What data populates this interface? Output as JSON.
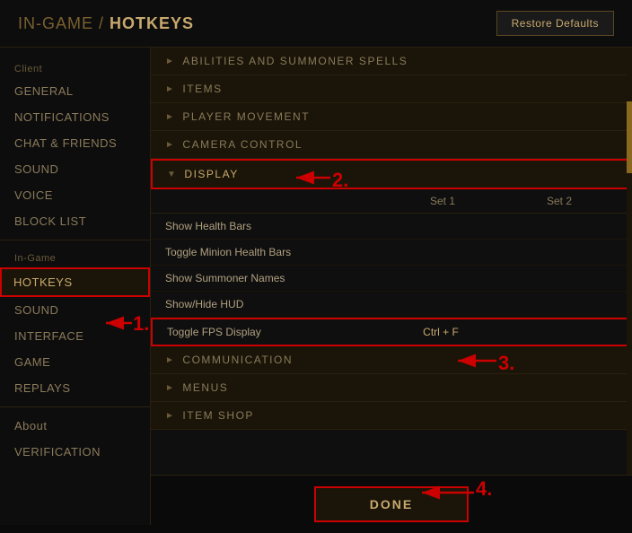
{
  "header": {
    "breadcrumb_prefix": "IN-GAME",
    "separator": " / ",
    "title": "HOTKEYS",
    "restore_button": "Restore Defaults"
  },
  "sidebar": {
    "client_label": "Client",
    "client_items": [
      {
        "id": "general",
        "label": "GENERAL",
        "active": false
      },
      {
        "id": "notifications",
        "label": "NOTIFICATIONS",
        "active": false
      },
      {
        "id": "chat-friends",
        "label": "CHAT & FRIENDS",
        "active": false
      },
      {
        "id": "sound-client",
        "label": "SOUND",
        "active": false
      },
      {
        "id": "voice",
        "label": "VOICE",
        "active": false
      },
      {
        "id": "block-list",
        "label": "BLOCK LIST",
        "active": false
      }
    ],
    "ingame_label": "In-Game",
    "ingame_items": [
      {
        "id": "hotkeys",
        "label": "HOTKEYS",
        "active": true
      },
      {
        "id": "sound-ingame",
        "label": "SOUND",
        "active": false
      },
      {
        "id": "interface",
        "label": "INTERFACE",
        "active": false
      },
      {
        "id": "game",
        "label": "GAME",
        "active": false
      },
      {
        "id": "replays",
        "label": "REPLAYS",
        "active": false
      }
    ],
    "other_items": [
      {
        "id": "about",
        "label": "About",
        "active": false
      },
      {
        "id": "verification",
        "label": "VERIFICATION",
        "active": false
      }
    ]
  },
  "content": {
    "sections": [
      {
        "id": "abilities",
        "label": "ABILITIES AND SUMMONER SPELLS",
        "expanded": false,
        "highlighted": false
      },
      {
        "id": "items",
        "label": "ITEMS",
        "expanded": false,
        "highlighted": false
      },
      {
        "id": "player-movement",
        "label": "PLAYER MOVEMENT",
        "expanded": false,
        "highlighted": false
      },
      {
        "id": "camera-control",
        "label": "CAMERA CONTROL",
        "expanded": false,
        "highlighted": false
      },
      {
        "id": "display",
        "label": "DISPLAY",
        "expanded": true,
        "highlighted": true
      }
    ],
    "set_headers": [
      "Set 1",
      "Set 2"
    ],
    "display_rows": [
      {
        "label": "Show Health Bars",
        "set1": "",
        "set2": "",
        "highlighted": false
      },
      {
        "label": "Toggle Minion Health Bars",
        "set1": "",
        "set2": "",
        "highlighted": false
      },
      {
        "label": "Show Summoner Names",
        "set1": "",
        "set2": "",
        "highlighted": false
      },
      {
        "label": "Show/Hide HUD",
        "set1": "",
        "set2": "",
        "highlighted": false
      },
      {
        "label": "Toggle FPS Display",
        "set1": "Ctrl + F",
        "set2": "",
        "highlighted": true
      }
    ],
    "bottom_sections": [
      {
        "id": "communication",
        "label": "COMMUNICATION",
        "expanded": false,
        "highlighted": false
      },
      {
        "id": "menus",
        "label": "MENUS",
        "expanded": false,
        "highlighted": false
      },
      {
        "id": "item-shop",
        "label": "ITEM SHOP",
        "expanded": false,
        "highlighted": false
      }
    ]
  },
  "footer": {
    "done_label": "DONE"
  },
  "annotations": [
    {
      "id": "1",
      "text": "1."
    },
    {
      "id": "2",
      "text": "2."
    },
    {
      "id": "3",
      "text": "3."
    },
    {
      "id": "4",
      "text": "4."
    }
  ]
}
